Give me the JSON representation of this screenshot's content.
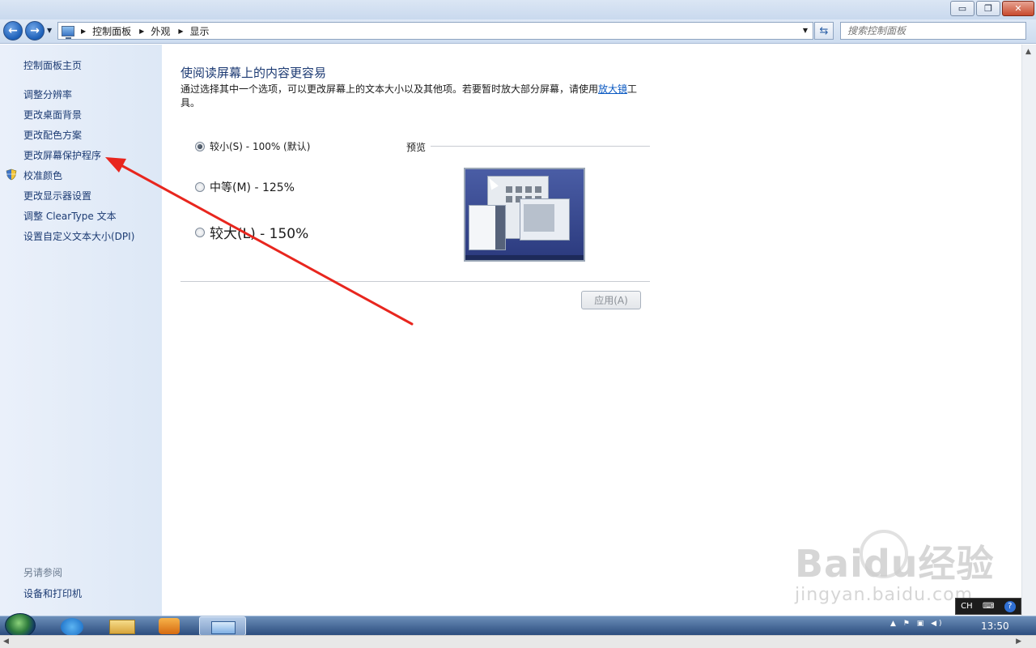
{
  "window": {
    "buttons": {
      "minimize": "▭",
      "maximize": "❐",
      "close": "✕"
    }
  },
  "nav": {
    "back_glyph": "←",
    "forward_glyph": "→",
    "dropdown_glyph": "▼",
    "breadcrumb": [
      "控制面板",
      "外观",
      "显示"
    ],
    "refresh_glyph": "⇆",
    "search_placeholder": "搜索控制面板"
  },
  "sidebar": {
    "home": "控制面板主页",
    "items": [
      "调整分辨率",
      "更改桌面背景",
      "更改配色方案",
      "更改屏幕保护程序",
      "校准颜色",
      "更改显示器设置",
      "调整 ClearType 文本",
      "设置自定义文本大小(DPI)"
    ],
    "see_also_title": "另请参阅",
    "see_also_items": [
      "设备和打印机"
    ]
  },
  "main": {
    "heading": "使阅读屏幕上的内容更容易",
    "desc_before": "通过选择其中一个选项，可以更改屏幕上的文本大小以及其他项。若要暂时放大部分屏幕，请使用",
    "desc_link": "放大镜",
    "desc_after": "工具。",
    "options": [
      {
        "label": "较小(S) - 100% (默认)",
        "checked": true
      },
      {
        "label": "中等(M) - 125%",
        "checked": false
      },
      {
        "label": "较大(L) - 150%",
        "checked": false
      }
    ],
    "preview_label": "预览",
    "apply_button": "应用(A)"
  },
  "taskbar": {
    "clock": "13:50",
    "tray_glyphs": "▲ ⚑ ▣ ◀)"
  },
  "language_bar": {
    "lang": "CH",
    "help": "?"
  },
  "watermark": {
    "main": "Baidu经验",
    "sub": "jingyan.baidu.com"
  },
  "colors": {
    "link": "#1c3b73",
    "heading": "#1c3a73",
    "annotation_arrow": "#e8261e"
  }
}
